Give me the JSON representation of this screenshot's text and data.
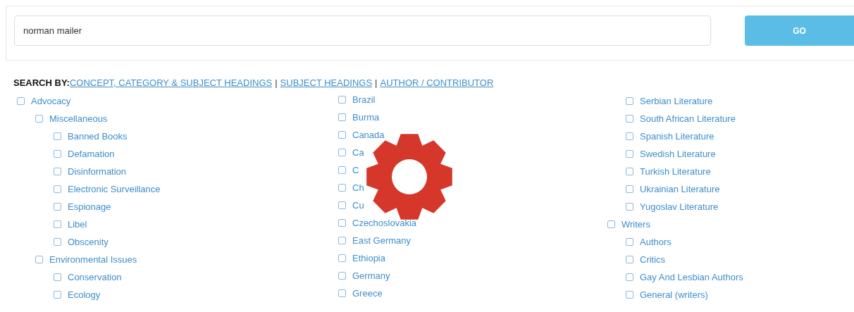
{
  "search": {
    "value": "norman mailer",
    "button": "GO"
  },
  "search_by": {
    "label": "SEARCH BY:",
    "links": [
      "CONCEPT, CATEGORY & SUBJECT HEADINGS",
      "SUBJECT HEADINGS",
      "AUTHOR / CONTRIBUTOR"
    ],
    "separator": "|"
  },
  "columns": [
    [
      {
        "label": "Advocacy",
        "checked": false,
        "children": [
          {
            "label": "Miscellaneous",
            "checked": false,
            "children": [
              {
                "label": "Banned Books",
                "checked": false
              },
              {
                "label": "Defamation",
                "checked": false
              },
              {
                "label": "Disinformation",
                "checked": false
              },
              {
                "label": "Electronic Surveillance",
                "checked": false
              },
              {
                "label": "Espionage",
                "checked": false
              },
              {
                "label": "Libel",
                "checked": false
              },
              {
                "label": "Obscenity",
                "checked": false
              }
            ]
          },
          {
            "label": "Environmental Issues",
            "checked": false,
            "children": [
              {
                "label": "Conservation",
                "checked": false
              },
              {
                "label": "Ecology",
                "checked": false
              }
            ]
          }
        ]
      }
    ],
    [
      {
        "label": "Brazil",
        "checked": false
      },
      {
        "label": "Burma",
        "checked": false
      },
      {
        "label": "Canada",
        "checked": false
      },
      {
        "label": "Ca",
        "checked": false
      },
      {
        "label": "C",
        "checked": false
      },
      {
        "label": "Ch",
        "checked": false
      },
      {
        "label": "Cu",
        "checked": false
      },
      {
        "label": "Czechoslovakia",
        "checked": false
      },
      {
        "label": "East Germany",
        "checked": false
      },
      {
        "label": "Ethiopia",
        "checked": false
      },
      {
        "label": "Germany",
        "checked": false
      },
      {
        "label": "Greece",
        "checked": false
      }
    ],
    [
      {
        "children": [
          {
            "label": "Serbian Literature",
            "checked": false
          },
          {
            "label": "South African Literature",
            "checked": false
          },
          {
            "label": "Spanish Literature",
            "checked": false
          },
          {
            "label": "Swedish Literature",
            "checked": false
          },
          {
            "label": "Turkish Literature",
            "checked": false
          },
          {
            "label": "Ukrainian Literature",
            "checked": false
          },
          {
            "label": "Yugoslav Literature",
            "checked": false
          }
        ]
      },
      {
        "label": "Writers",
        "checked": false,
        "children": [
          {
            "label": "Authors",
            "checked": false
          },
          {
            "label": "Critics",
            "checked": false
          },
          {
            "label": "Gay And Lesbian Authors",
            "checked": false
          },
          {
            "label": "General (writers)",
            "checked": false
          }
        ]
      }
    ]
  ],
  "loading": true
}
